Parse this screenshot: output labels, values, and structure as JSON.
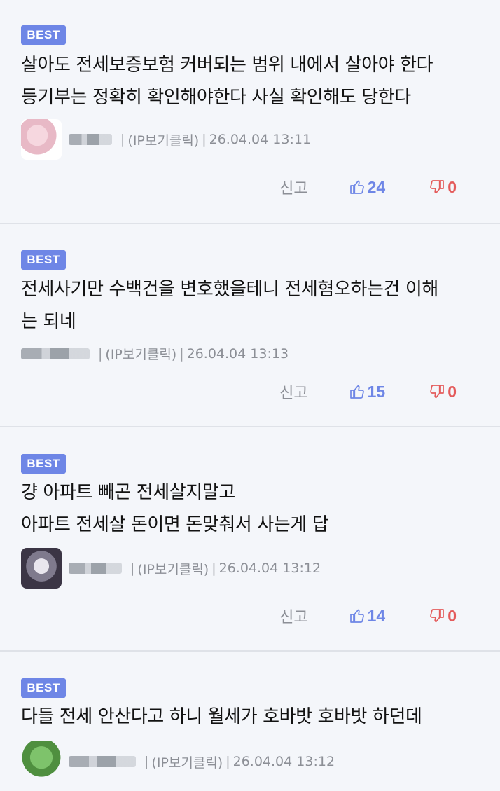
{
  "comments": [
    {
      "badge": "BEST",
      "text": "살아도 전세보증보험 커버되는 범위 내에서 살아야 한다\n등기부는 정확히 확인해야한다 사실 확인해도 당한다",
      "ip_label": "(IP보기클릭)",
      "date": "26.04.04 13:11",
      "report": "신고",
      "up": "24",
      "down": "0"
    },
    {
      "badge": "BEST",
      "text": "전세사기만 수백건을 변호했을테니 전세혐오하는건 이해\n는 되네",
      "ip_label": "(IP보기클릭)",
      "date": "26.04.04 13:13",
      "report": "신고",
      "up": "15",
      "down": "0"
    },
    {
      "badge": "BEST",
      "text": "걍 아파트 빼곤 전세살지말고\n아파트 전세살 돈이면 돈맞춰서 사는게 답",
      "ip_label": "(IP보기클릭)",
      "date": "26.04.04 13:12",
      "report": "신고",
      "up": "14",
      "down": "0"
    },
    {
      "badge": "BEST",
      "text": "다들 전세 안산다고 하니 월세가 호바밧 호바밧 하던데",
      "ip_label": "(IP보기클릭)",
      "date": "26.04.04 13:12"
    }
  ],
  "colors": {
    "badge": "#6e86e6",
    "up": "#6e86e6",
    "down": "#e45b5b",
    "meta": "#8c8f96"
  }
}
